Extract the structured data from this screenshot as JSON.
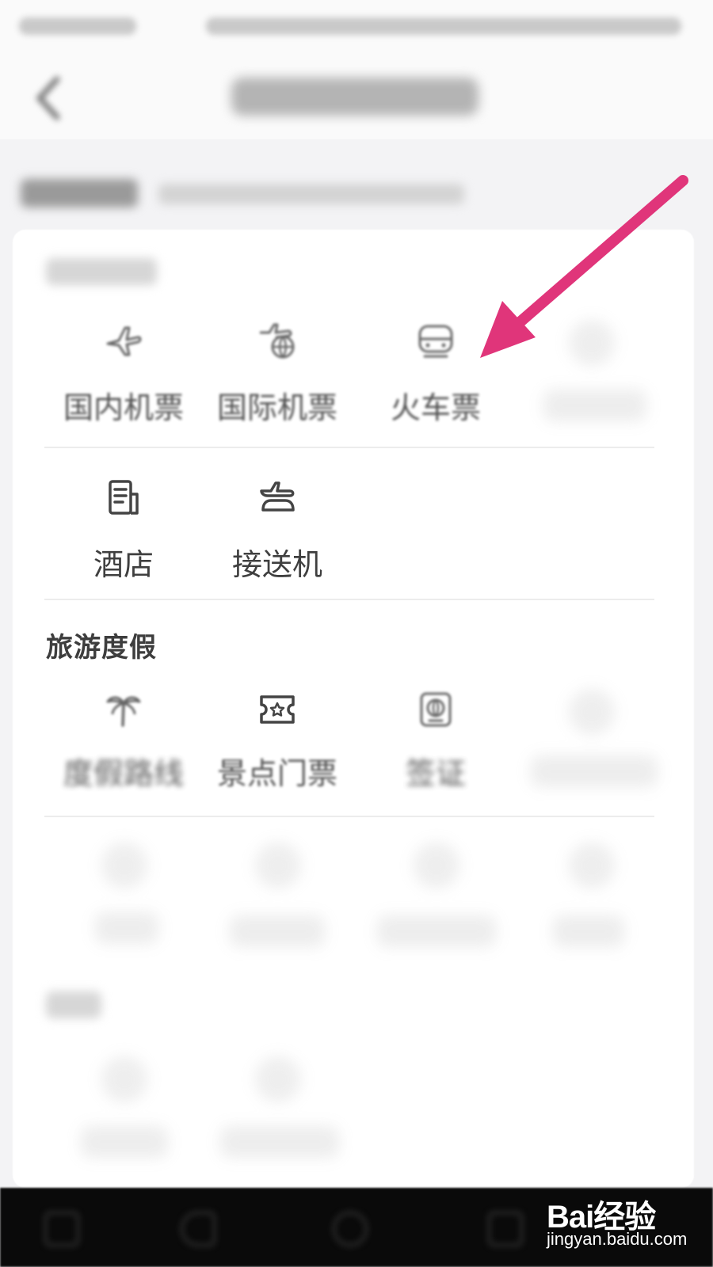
{
  "statusbar": {},
  "header": {},
  "section_travel": {
    "label": "旅游度假"
  },
  "grid_transport_row1": [
    {
      "label": "国内机票",
      "icon": "airplane-icon"
    },
    {
      "label": "国际机票",
      "icon": "globe-airplane-icon"
    },
    {
      "label": "火车票",
      "icon": "train-icon"
    }
  ],
  "grid_transport_row2": [
    {
      "label": "酒店",
      "icon": "hotel-document-icon"
    },
    {
      "label": "接送机",
      "icon": "car-airplane-icon"
    }
  ],
  "grid_travel_row1": [
    {
      "label": "度假路线",
      "icon": "palm-tree-icon"
    },
    {
      "label": "景点门票",
      "icon": "ticket-star-icon"
    },
    {
      "label": "签证",
      "icon": "passport-icon"
    }
  ],
  "annotation": {
    "arrow_color": "#e0357a",
    "points_to": "火车票"
  },
  "watermark": {
    "logo_text": "Bai经验",
    "url": "jingyan.baidu.com"
  },
  "colors": {
    "background": "#f3f3f5",
    "card": "#ffffff",
    "navbar": "#0a0a0a",
    "arrow": "#e0357a"
  }
}
